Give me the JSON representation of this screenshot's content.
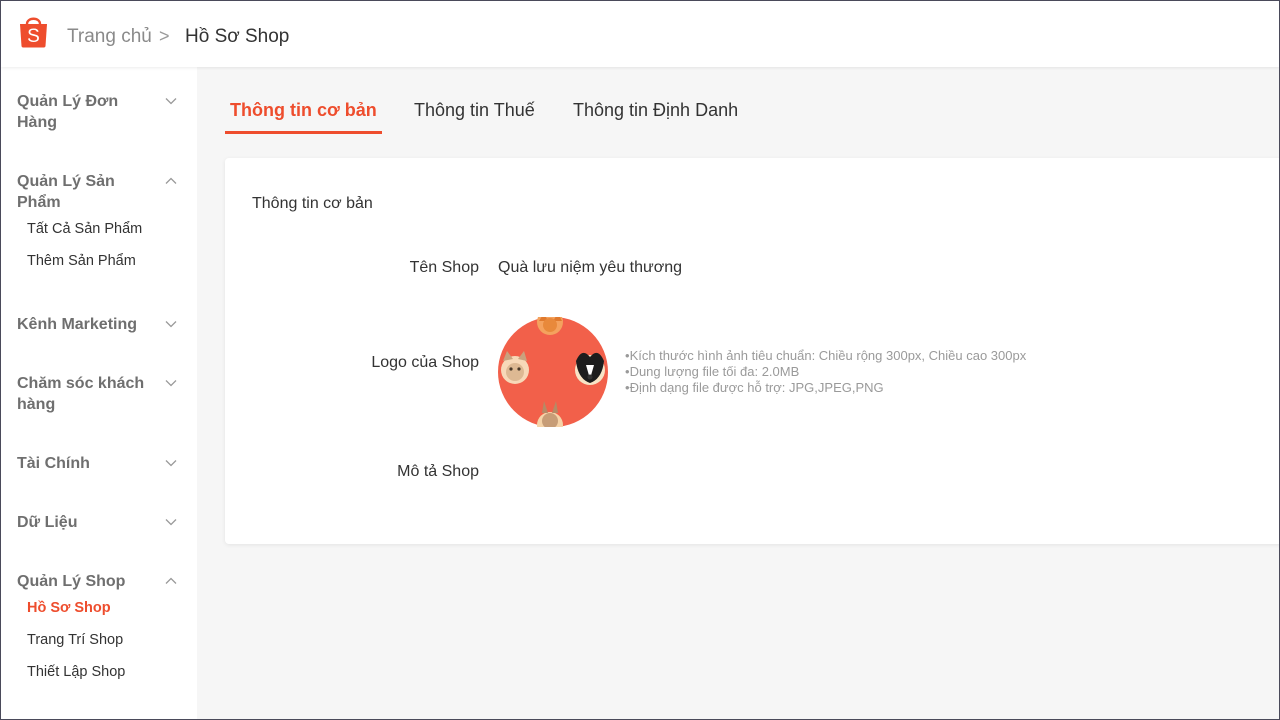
{
  "header": {
    "logo_letter": "S",
    "breadcrumb_home": "Trang chủ",
    "breadcrumb_separator": ">",
    "breadcrumb_current": "Hồ Sơ Shop",
    "brand_color": "#ee4d2d"
  },
  "sidebar": {
    "groups": [
      {
        "title": "Quản Lý Đơn Hàng",
        "expanded": false,
        "items": []
      },
      {
        "title": "Quản Lý Sản Phẩm",
        "expanded": true,
        "items": [
          "Tất Cả Sản Phẩm",
          "Thêm Sản Phẩm"
        ]
      },
      {
        "title": "Kênh Marketing",
        "expanded": false,
        "items": []
      },
      {
        "title": "Chăm sóc khách hàng",
        "expanded": false,
        "items": []
      },
      {
        "title": "Tài Chính",
        "expanded": false,
        "items": []
      },
      {
        "title": "Dữ Liệu",
        "expanded": false,
        "items": []
      },
      {
        "title": "Quản Lý Shop",
        "expanded": true,
        "items": [
          "Hồ Sơ Shop",
          "Trang Trí Shop",
          "Thiết Lập Shop"
        ],
        "active_item": "Hồ Sơ Shop"
      }
    ]
  },
  "tabs": [
    {
      "label": "Thông tin cơ bản",
      "active": true
    },
    {
      "label": "Thông tin Thuế",
      "active": false
    },
    {
      "label": "Thông tin Định Danh",
      "active": false
    }
  ],
  "card": {
    "title": "Thông tin cơ bản",
    "shop_name_label": "Tên Shop",
    "shop_name_value": "Quà lưu niệm yêu thương",
    "logo_label": "Logo của Shop",
    "description_label": "Mô tả Shop",
    "logo_hints": [
      "Kích thước hình ảnh tiêu chuẩn: Chiều rộng 300px, Chiều cao 300px",
      "Dung lượng file tối đa: 2.0MB",
      "Định dạng file được hỗ trợ: JPG,JPEG,PNG"
    ]
  },
  "icons": {
    "logo": "shopee-bag-icon",
    "chevron_down": "chevron-down-icon",
    "chevron_up": "chevron-up-icon"
  }
}
